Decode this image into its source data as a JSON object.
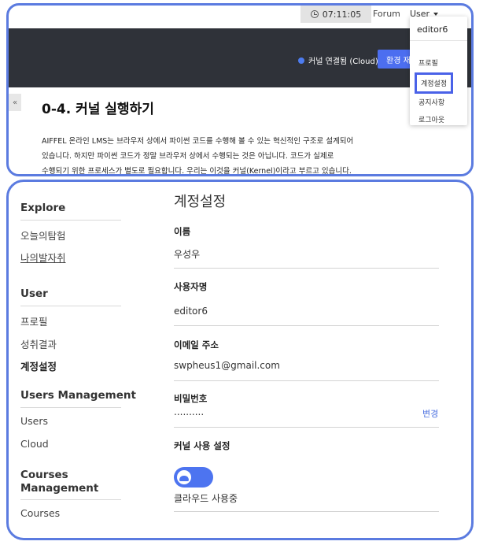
{
  "header": {
    "timer": "07:11:05",
    "forum": "Forum",
    "user_menu": "User",
    "kernel_status": "커널 연결됨 (Cloud)",
    "env_button": "환경 재"
  },
  "user_dropdown": {
    "username": "editor6",
    "items": [
      "프로필",
      "계정설정",
      "공지사항",
      "로그아웃"
    ],
    "selected": "계정설정"
  },
  "lesson": {
    "collapse": "«",
    "title": "0-4. 커널 실행하기",
    "body": [
      "AIFFEL 온라인 LMS는 브라우저 상에서 파이썬 코드를 수행해 볼 수 있는 혁신적인 구조로 설계되어",
      "있습니다. 하지만 파이썬 코드가 정말 브라우저 상에서 수행되는 것은 아닙니다. 코드가 실제로",
      "수행되기 위한 프로세스가 별도로 필요합니다. 우리는 이것을 커널(Kernel)이라고 부르고 있습니다."
    ]
  },
  "sidebar": {
    "sections": [
      {
        "heading": "Explore",
        "items": [
          "오늘의탐험",
          "나의발자취"
        ]
      },
      {
        "heading": "User",
        "items": [
          "프로필",
          "성취결과",
          "계정설정"
        ]
      },
      {
        "heading": "Users Management",
        "items": [
          "Users",
          "Cloud"
        ]
      },
      {
        "heading": "Courses Management",
        "items": [
          "Courses"
        ]
      }
    ],
    "current": "계정설정"
  },
  "account": {
    "title": "계정설정",
    "name_label": "이름",
    "name_value": "우성우",
    "username_label": "사용자명",
    "username_value": "editor6",
    "email_label": "이메일 주소",
    "email_value": "swpheus1@gmail.com",
    "password_label": "비밀번호",
    "password_value": "..........",
    "change_link": "변경",
    "kernel_label": "커널 사용 설정",
    "kernel_toggle_on": true,
    "kernel_value": "클라우드 사용중"
  },
  "colors": {
    "accent": "#4c6ef0",
    "highlight_border": "#5b7be0",
    "dark_bar": "#2f3239"
  }
}
